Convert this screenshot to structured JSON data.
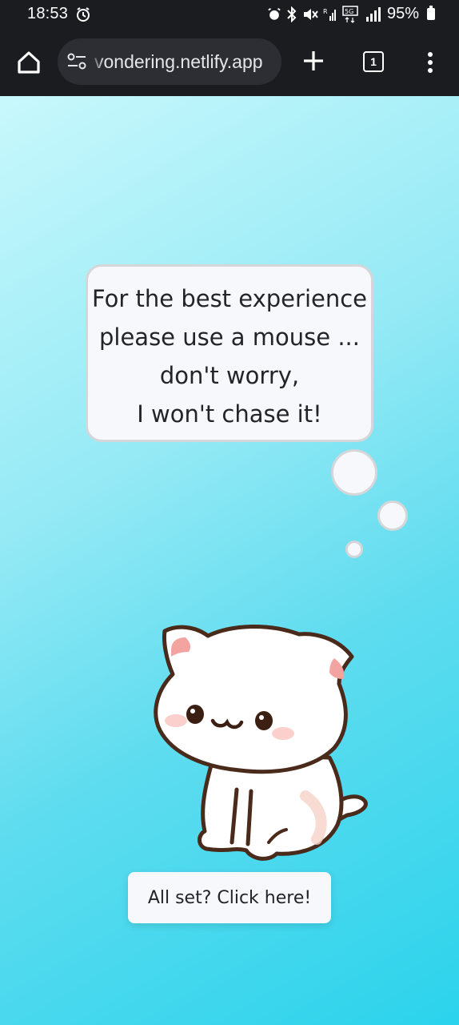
{
  "status_bar": {
    "time": "18:53",
    "battery": "95%",
    "icons": [
      "alarm-icon",
      "bluetooth-icon",
      "mute-icon",
      "call-signal-icon",
      "5g-icon",
      "signal-icon",
      "battery-icon"
    ]
  },
  "browser": {
    "url": "vondering.netlify.app",
    "tab_count": "1",
    "icons": [
      "home-icon",
      "site-settings-icon",
      "plus-icon",
      "tabs-icon",
      "more-vert-icon"
    ]
  },
  "page": {
    "bubble_lines": [
      "For the best experience",
      "please use a mouse ...",
      "don't worry,",
      "I won't chase it!"
    ],
    "button_label": "All set? Click here!"
  },
  "colors": {
    "background_start": "#c8f8fc",
    "background_end": "#2bd3ec",
    "bubble": "#f7f8fb",
    "bubble_border": "#d4d6da",
    "text": "#222428"
  }
}
